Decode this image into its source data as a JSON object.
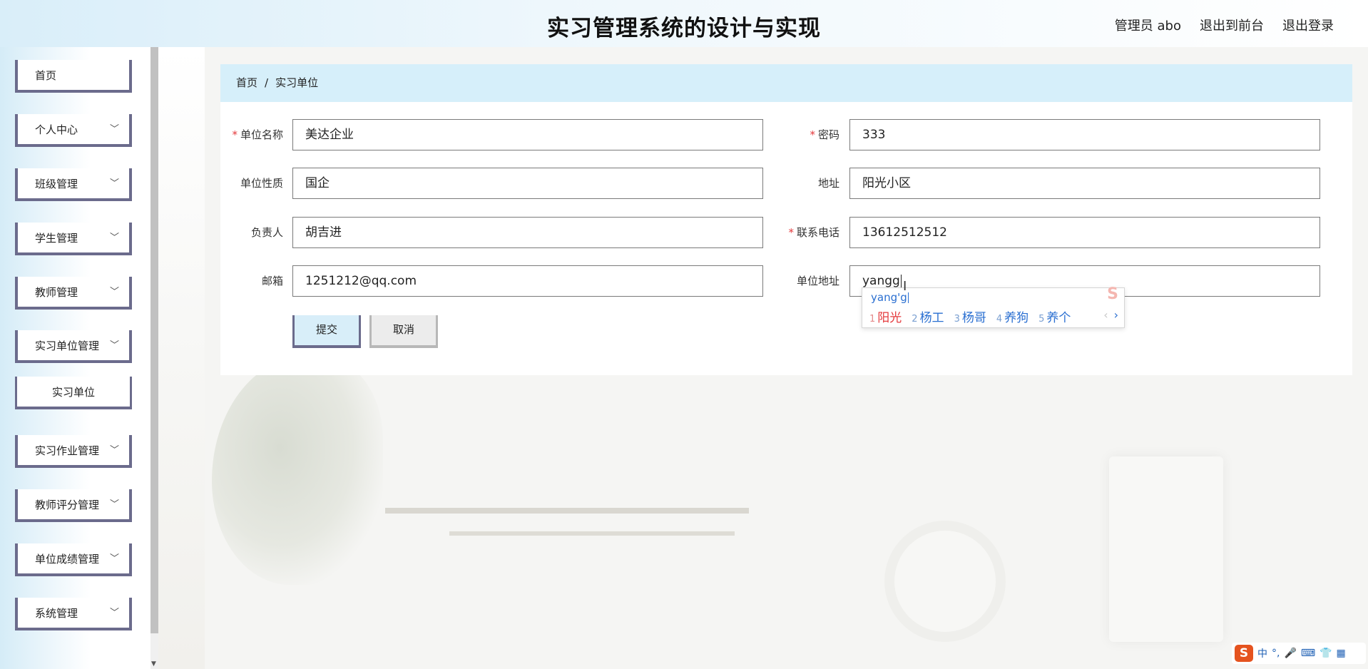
{
  "header": {
    "title": "实习管理系统的设计与实现",
    "links": [
      "管理员 abo",
      "退出到前台",
      "退出登录"
    ]
  },
  "sidebar": {
    "items": [
      {
        "label": "首页"
      },
      {
        "label": "个人中心"
      },
      {
        "label": "班级管理"
      },
      {
        "label": "学生管理"
      },
      {
        "label": "教师管理"
      },
      {
        "label": "实习单位管理"
      },
      {
        "label": "实习单位"
      },
      {
        "label": "实习作业管理"
      },
      {
        "label": "教师评分管理"
      },
      {
        "label": "单位成绩管理"
      },
      {
        "label": "系统管理"
      }
    ]
  },
  "breadcrumb": {
    "home": "首页",
    "separator": "/",
    "current": "实习单位"
  },
  "form": {
    "unit_name": {
      "label": "单位名称",
      "value": "美达企业"
    },
    "password": {
      "label": "密码",
      "value": "333"
    },
    "unit_type": {
      "label": "单位性质",
      "value": "国企"
    },
    "address": {
      "label": "地址",
      "value": "阳光小区"
    },
    "manager": {
      "label": "负责人",
      "value": "胡吉进"
    },
    "phone": {
      "label": "联系电话",
      "value": "13612512512"
    },
    "email": {
      "label": "邮箱",
      "value": "1251212@qq.com"
    },
    "unit_address": {
      "label": "单位地址",
      "value": "yangg"
    },
    "required_mark": "*",
    "submit_label": "提交",
    "cancel_label": "取消"
  },
  "ime": {
    "composition": "yang'g",
    "candidates": [
      {
        "num": "1",
        "text": "阳光"
      },
      {
        "num": "2",
        "text": "杨工"
      },
      {
        "num": "3",
        "text": "杨哥"
      },
      {
        "num": "4",
        "text": "养狗"
      },
      {
        "num": "5",
        "text": "养个"
      }
    ],
    "prev": "‹",
    "next": "›",
    "logo": "S",
    "toolbar": {
      "logo": "S",
      "mode": "中",
      "punct": "°,"
    }
  },
  "colors": {
    "accent": "#6b6b8c",
    "breadcrumb_bg": "#d6effa",
    "required": "#e4393c",
    "ime_text": "#2a6fd1"
  }
}
